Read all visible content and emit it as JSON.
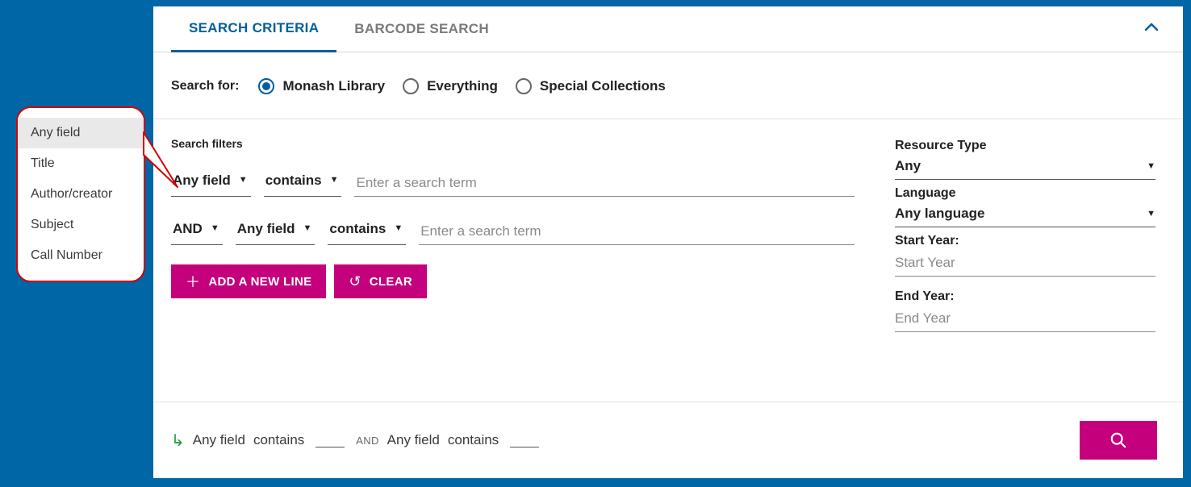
{
  "tabs": {
    "criteria": "SEARCH CRITERIA",
    "barcode": "BARCODE SEARCH"
  },
  "scope": {
    "label": "Search for:",
    "monash": "Monash Library",
    "everything": "Everything",
    "special": "Special Collections"
  },
  "filters": {
    "title": "Search filters",
    "row1": {
      "field": "Any field",
      "op": "contains",
      "placeholder": "Enter a search term"
    },
    "row2": {
      "bool": "AND",
      "field": "Any field",
      "op": "contains",
      "placeholder": "Enter a search term"
    }
  },
  "buttons": {
    "add": "ADD A NEW LINE",
    "clear": "CLEAR"
  },
  "side": {
    "resource_type_label": "Resource Type",
    "resource_type_value": "Any",
    "language_label": "Language",
    "language_value": "Any language",
    "start_year_label": "Start Year:",
    "start_year_placeholder": "Start Year",
    "end_year_label": "End Year:",
    "end_year_placeholder": "End Year"
  },
  "summary": {
    "part1a": "Any field",
    "part1b": "contains",
    "and": "AND",
    "part2a": "Any field",
    "part2b": "contains"
  },
  "callout": {
    "items": [
      "Any field",
      "Title",
      "Author/creator",
      "Subject",
      "Call Number"
    ]
  }
}
